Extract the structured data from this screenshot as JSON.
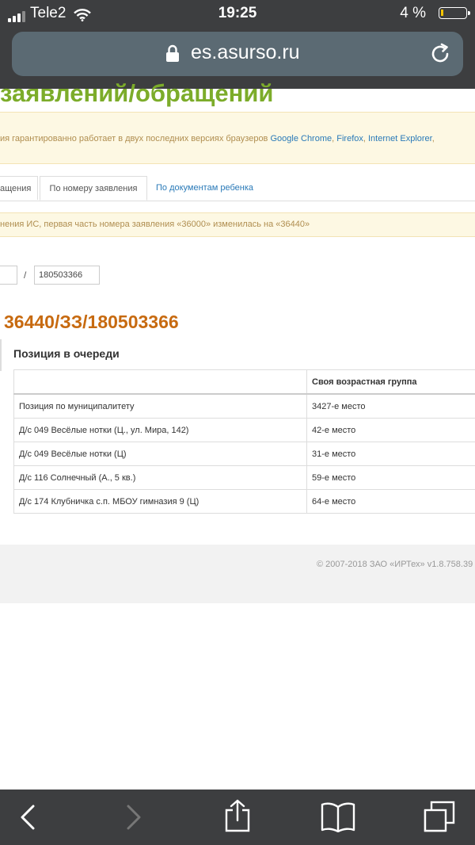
{
  "status": {
    "carrier": "Tele2",
    "time": "19:25",
    "battery": "4 %"
  },
  "browser": {
    "url": "es.asurso.ru"
  },
  "page": {
    "heading": "заявлений/обращений",
    "browser_notice": {
      "text": "ия гарантированно работает в двух последних версиях браузеров",
      "links": [
        "Google Chrome",
        "Firefox",
        "Internet Explorer"
      ],
      "sep1": ", ",
      "sep2": ", ",
      "tail": ","
    },
    "tabs": [
      "ащения",
      "По номеру заявления",
      "По документам ребенка"
    ],
    "notice2": "нения ИС, первая часть номера заявления «36000» изменилась на «36440»",
    "search": {
      "separator": "/",
      "number": "180503366"
    },
    "application_number": "36440/ЗЗ/180503366",
    "queue": {
      "title": "Позиция в очереди",
      "header": [
        "",
        "Своя возрастная группа"
      ],
      "rows": [
        {
          "name": "Позиция по муниципалитету",
          "place": "3427-е место"
        },
        {
          "name": "Д/с 049 Весёлые нотки (Ц., ул. Мира, 142)",
          "place": "42-е место"
        },
        {
          "name": "Д/с 049 Весёлые нотки (Ц)",
          "place": "31-е место"
        },
        {
          "name": "Д/с 116 Солнечный (А., 5 кв.)",
          "place": "59-е место"
        },
        {
          "name": "Д/с 174 Клубничка с.п. МБОУ гимназия 9 (Ц)",
          "place": "64-е место"
        }
      ]
    },
    "footer": "© 2007-2018 ЗАО «ИРТех» v1.8.758.39"
  }
}
